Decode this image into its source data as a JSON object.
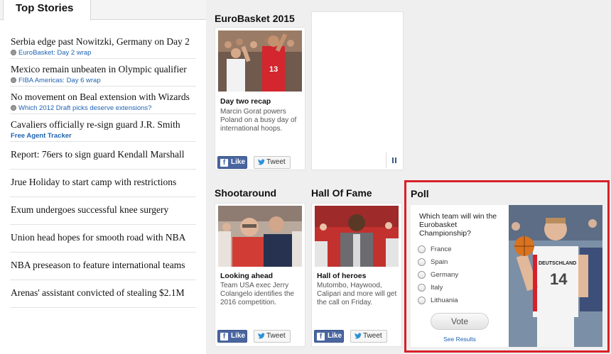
{
  "top_stories": {
    "tab_label": "Top Stories",
    "items": [
      {
        "headline": "Serbia edge past Nowitzki, Germany on Day 2",
        "sub": "EuroBasket: Day 2 wrap",
        "sub_icon": "dot-icon"
      },
      {
        "headline": "Mexico remain unbeaten in Olympic qualifier",
        "sub": "FIBA Americas: Day 6 wrap",
        "sub_icon": "dot-icon"
      },
      {
        "headline": "No movement on Beal extension with Wizards",
        "sub": "Which 2012 Draft picks deserve extensions?",
        "sub_icon": "dot-icon"
      },
      {
        "headline": "Cavaliers officially re-sign guard J.R. Smith",
        "sub": "Free Agent Tracker"
      },
      {
        "headline": "Report: 76ers to sign guard Kendall Marshall"
      },
      {
        "headline": "Jrue Holiday to start camp with restrictions"
      },
      {
        "headline": "Exum undergoes successful knee surgery"
      },
      {
        "headline": "Union head hopes for smooth road with NBA"
      },
      {
        "headline": "NBA preseason to feature international teams"
      },
      {
        "headline": "Arenas' assistant convicted of stealing $2.1M"
      }
    ]
  },
  "cards": {
    "eurobasket": {
      "section": "EuroBasket 2015",
      "title": "Day two recap",
      "text": "Marcin Gorat powers Poland on a busy day of international hoops.",
      "jersey": "13"
    },
    "shootaround": {
      "section": "Shootaround",
      "title": "Looking ahead",
      "text": "Team USA exec Jerry Colangelo identifies the 2016 competition."
    },
    "hall_of_fame": {
      "section": "Hall Of Fame",
      "title": "Hall of heroes",
      "text": "Mutombo, Haywood, Calipari and more will get the call on Friday."
    }
  },
  "social": {
    "like_label": "Like",
    "tweet_label": "Tweet"
  },
  "poll": {
    "title": "Poll",
    "question": "Which team will win the Eurobasket Championship?",
    "options": [
      "France",
      "Spain",
      "Germany",
      "Italy",
      "Lithuania"
    ],
    "vote_label": "Vote",
    "results_label": "See Results",
    "jersey_text": "DEUTSCHLAND",
    "jersey_number": "14"
  },
  "colors": {
    "link": "#1f63b0",
    "highlight_frame": "#d8202a",
    "facebook": "#4a66a0"
  }
}
